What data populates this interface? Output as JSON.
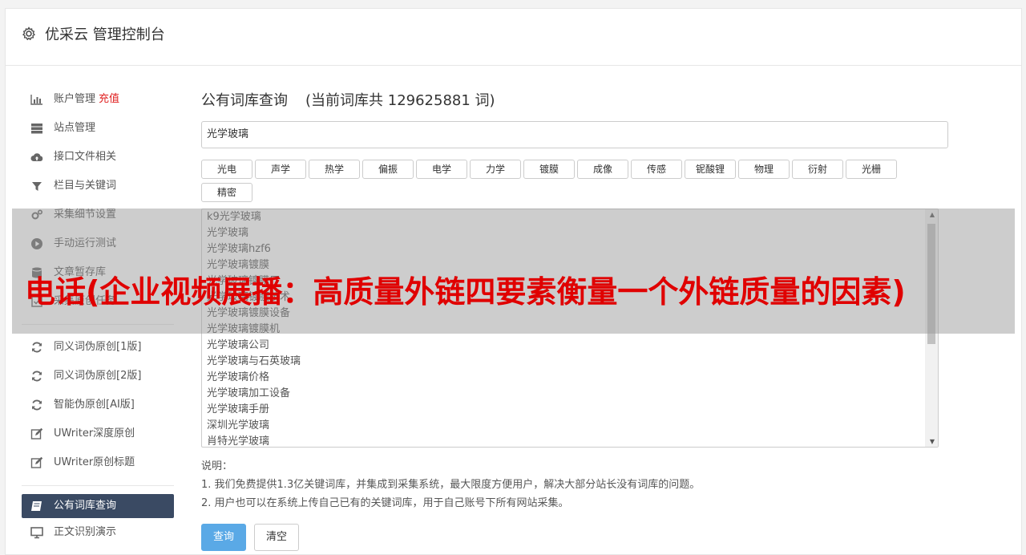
{
  "header": {
    "title": "优采云 管理控制台",
    "icon": "gear-icon"
  },
  "sidebar": {
    "items": [
      {
        "label": "账户管理",
        "badge": "充值",
        "icon": "bar-chart-icon"
      },
      {
        "label": "站点管理",
        "icon": "server-icon"
      },
      {
        "label": "接口文件相关",
        "icon": "cloud-upload-icon"
      },
      {
        "label": "栏目与关键词",
        "icon": "filter-icon"
      },
      {
        "label": "采集细节设置",
        "icon": "gears-icon"
      },
      {
        "label": "手动运行测试",
        "icon": "play-icon"
      },
      {
        "label": "文章暂存库",
        "icon": "database-icon"
      },
      {
        "label": "采集原创任务",
        "icon": "tasks-icon"
      },
      {
        "label": "同义词伪原创[1版]",
        "icon": "refresh-icon"
      },
      {
        "label": "同义词伪原创[2版]",
        "icon": "refresh-icon"
      },
      {
        "label": "智能伪原创[AI版]",
        "icon": "refresh-icon"
      },
      {
        "label": "UWriter深度原创",
        "icon": "edit-icon"
      },
      {
        "label": "UWriter原创标题",
        "icon": "edit-icon"
      },
      {
        "label": "公有词库查询",
        "icon": "book-icon",
        "active": true
      },
      {
        "label": "正文识别演示",
        "icon": "monitor-icon"
      }
    ]
  },
  "main": {
    "title": "公有词库查询",
    "count_text": "(当前词库共 129625881 词)",
    "search_value": "光学玻璃",
    "tags": [
      "光电",
      "声学",
      "热学",
      "偏振",
      "电学",
      "力学",
      "镀膜",
      "成像",
      "传感",
      "铌酸锂",
      "物理",
      "衍射",
      "光栅",
      "精密"
    ],
    "results": [
      "k9光学玻璃",
      "光学玻璃",
      "光学玻璃hzf6",
      "光学玻璃镀膜",
      "光学玻璃镀膜厂",
      "光学玻璃镀膜技术",
      "光学玻璃镀膜设备",
      "光学玻璃镀膜机",
      "光学玻璃公司",
      "光学玻璃与石英玻璃",
      "光学玻璃价格",
      "光学玻璃加工设备",
      "光学玻璃手册",
      "深圳光学玻璃",
      "肖特光学玻璃"
    ],
    "notes_title": "说明：",
    "notes": [
      "1. 我们免费提供1.3亿关键词库，并集成到采集系统，最大限度方便用户，解决大部分站长没有词库的问题。",
      "2. 用户也可以在系统上传自己已有的关键词库，用于自己账号下所有网站采集。"
    ],
    "btn_query": "查询",
    "btn_clear": "清空"
  },
  "overlay": {
    "headline": "电话(企业视频展播：高质量外链四要素衡量一个外链质量的因素)"
  },
  "colors": {
    "sidebar_active_bg": "#3a4a63",
    "primary": "#5aa9e6",
    "recharge": "#e02020",
    "headline": "#e00000"
  }
}
